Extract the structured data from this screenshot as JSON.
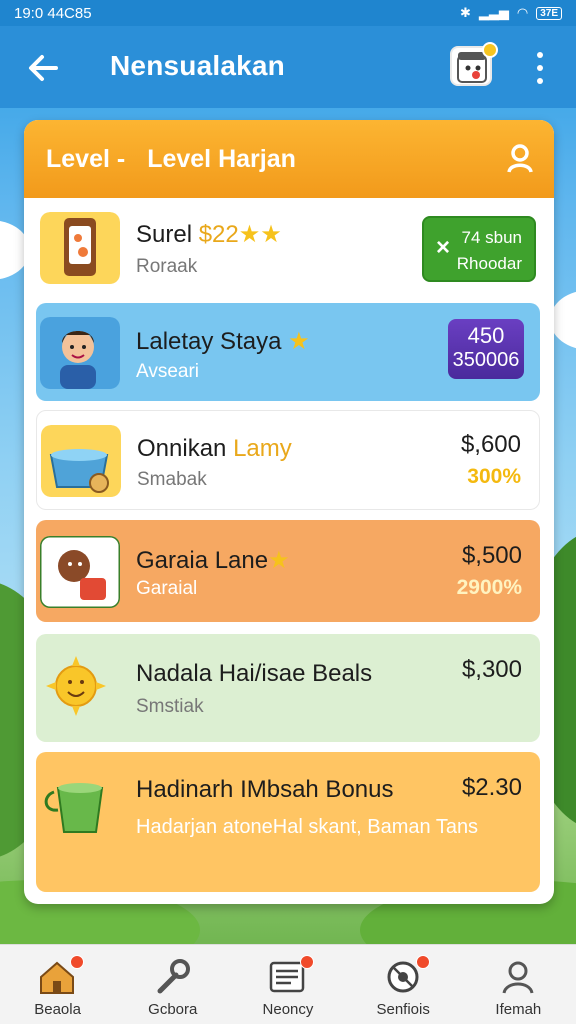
{
  "status_bar": {
    "time": "19:0 44C85",
    "battery": "37E"
  },
  "app_bar": {
    "title": "Nensualakan"
  },
  "card": {
    "header_prefix": "Level -",
    "header_title": "Level Harjan"
  },
  "rows": [
    {
      "title": "Surel",
      "title_extra": "$22",
      "stars": "★★",
      "subtitle": "Roraak",
      "button_line1": "74 sbun",
      "button_line2": "Rhoodar",
      "button_icon": "×",
      "bg": "#ffffff"
    },
    {
      "title": "Laletay Staya",
      "star": "★",
      "subtitle": "Avseari",
      "badge_top": "450",
      "badge_bottom": "350006",
      "bg": "#79c6f0"
    },
    {
      "title": "Onnikan",
      "title_extra": "Lamy",
      "subtitle": "Smabak",
      "price": "$,600",
      "percent": "300%",
      "bg": "#ffffff"
    },
    {
      "title": "Garaia Lane",
      "star": "★",
      "subtitle": "Garaial",
      "price": "$,500",
      "percent": "2900%",
      "bg": "#f6a862"
    },
    {
      "title": "Nadala Hai/isae Beals",
      "subtitle": "Smstiak",
      "price": "$,300",
      "bg": "#dcefd2"
    },
    {
      "title": "Hadinarh IMbsah Bonus",
      "price": "$2.30",
      "description": "Hadarjan atoneHal skant, Baman Tans",
      "bg": "#ffc563"
    }
  ],
  "bottom_nav": [
    {
      "label": "Beaola",
      "icon": "home-icon",
      "badge": true
    },
    {
      "label": "Gcbora",
      "icon": "wrench-icon",
      "badge": false
    },
    {
      "label": "Neoncy",
      "icon": "news-icon",
      "badge": true
    },
    {
      "label": "Senfiois",
      "icon": "settings-icon",
      "badge": true
    },
    {
      "label": "Ifemah",
      "icon": "profile-icon",
      "badge": false
    }
  ],
  "colors": {
    "app_bar": "#2b8fd8",
    "header_orange": "#f29a1b",
    "claim_green": "#3fa22d",
    "badge_purple": "#5a34b0",
    "percent_gold": "#f4b90f"
  }
}
